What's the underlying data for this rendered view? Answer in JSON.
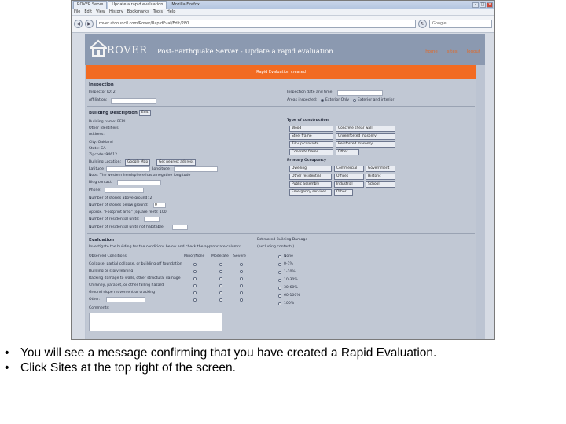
{
  "browser": {
    "tabs": [
      "ROVER Serve",
      "Update a rapid evaluation"
    ],
    "app_title": "Mozilla Firefox",
    "menu": [
      "File",
      "Edit",
      "View",
      "History",
      "Bookmarks",
      "Tools",
      "Help"
    ],
    "url": "rover.atcouncil.com/Rover/RapidEval/Edit/280",
    "search_placeholder": "Google"
  },
  "header": {
    "logo": "ROVER",
    "title": "Post-Earthquake Server - Update a rapid evaluation",
    "links": [
      "home",
      "sites",
      "logout"
    ]
  },
  "alert": {
    "text": "Rapid Evaluation created"
  },
  "inspection": {
    "heading": "Inspection",
    "inspector_id": "Inspector ID: 2",
    "affiliation": "Affiliation:",
    "date_time": "Inspection date and time:",
    "areas_inspected": "Areas inspected:",
    "exterior_only": "Exterior Only",
    "exterior_interior": "Exterior and interior"
  },
  "building": {
    "heading": "Building Description",
    "edit_label": "Edit",
    "name": "Building name: EERI",
    "other_identifiers": "Other Identifiers:",
    "address": "Address:",
    "city": "City: Oakland",
    "state": "State: CA",
    "zip": "Zipcode: 94612",
    "location": "Building Location:",
    "google_map": "Google Map",
    "get_address": "Get nearest address",
    "latitude": "Latitude",
    "longitude": "Longitude",
    "note": "Note: The western hemisphere has a negative longitude",
    "bldg_contact": "Bldg contact:",
    "phone": "Phone:",
    "stories_above": "Number of stories above ground: 2",
    "stories_below": "Number of stories below ground:",
    "stories_below_value": "0",
    "footprint": "Approx. \"Footprint area\" (square feet): 100",
    "residential_units": "Number of residential units:",
    "units_not_habitable": "Number of residential units not habitable:"
  },
  "construction": {
    "heading": "Type of construction",
    "options": [
      "Wood",
      "Concrete shear wall",
      "Steel frame",
      "Unreinforced masonry",
      "Tilt-up concrete",
      "Reinforced masonry",
      "Concrete frame",
      "Other"
    ]
  },
  "occupancy": {
    "heading": "Primary Occupancy",
    "options": [
      "Dwelling",
      "Commercial",
      "Government",
      "Other residential",
      "Offices",
      "Historic",
      "Public assembly",
      "Industrial",
      "School",
      "Emergency services",
      "Other"
    ]
  },
  "evaluation": {
    "heading": "Evaluation",
    "instruction": "Investigate the building for the conditions below and check the appropriate column:",
    "observed": "Observed Conditions:",
    "columns": [
      "Minor/None",
      "Moderate",
      "Severe"
    ],
    "conditions": [
      "Collapse, partial collapse, or building off foundation",
      "Building or story leaning",
      "Racking damage to walls, other structural damage",
      "Chimney, parapet, or other falling hazard",
      "Ground slope movement or cracking",
      "Other:"
    ],
    "comments": "Comments:",
    "damage_heading": "Estimated Building Damage",
    "damage_sub": "(excluding contents)",
    "damage_options": [
      "None",
      "0-1%",
      "1-10%",
      "10-30%",
      "30-60%",
      "60-100%",
      "100%"
    ]
  },
  "caption": {
    "line1": "You will see a message confirming that you have created a Rapid Evaluation.",
    "line2": "Click Sites at the top right of the screen."
  }
}
